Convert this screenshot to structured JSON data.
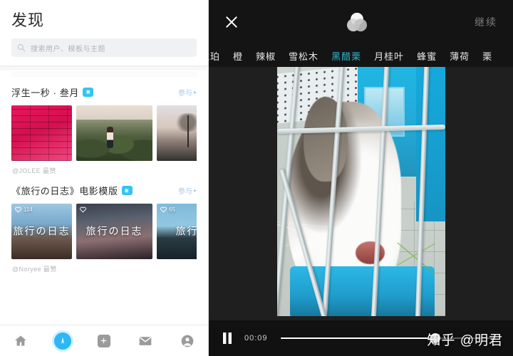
{
  "left_app": {
    "title": "发现",
    "search": {
      "placeholder": "搜索用户、模板与主题",
      "icon": "search-icon"
    },
    "sections": [
      {
        "title": "浮生一秒 · 叁月",
        "badge_text": "新",
        "action_label": "参与",
        "action_chevron": "▸",
        "byline": "@JOLEE 最赞",
        "cards": [
          {
            "art": "brick",
            "caption": "",
            "likes": ""
          },
          {
            "art": "walk",
            "caption": "",
            "likes": ""
          },
          {
            "art": "dusk",
            "caption": "",
            "likes": ""
          }
        ]
      },
      {
        "title": "《旅行の日志》电影模版",
        "badge_text": "新",
        "action_label": "参与",
        "action_chevron": "▸",
        "byline": "@Noryee 最赞",
        "cards": [
          {
            "art": "travel-a",
            "caption": "旅行の日志",
            "likes": "114"
          },
          {
            "art": "travel-b",
            "caption": "旅行の日志",
            "likes": ""
          },
          {
            "art": "travel-c",
            "caption": "旅行",
            "likes": "65"
          }
        ]
      }
    ],
    "tabbar": [
      {
        "name": "home",
        "label": "首页",
        "active": false
      },
      {
        "name": "discover",
        "label": "发现",
        "active": true
      },
      {
        "name": "create",
        "label": "创作",
        "active": false
      },
      {
        "name": "messages",
        "label": "消息",
        "active": false
      },
      {
        "name": "profile",
        "label": "我的",
        "active": false
      }
    ],
    "accent_color": "#2db7f5",
    "badge_color": "#35c3f3"
  },
  "right_app": {
    "topbar": {
      "close_icon": "close-icon",
      "filter_icon": "venn-filter-icon",
      "continue_label": "继续"
    },
    "filters": {
      "selected": "黑醋栗",
      "selected_color": "#33b6c9",
      "items": [
        {
          "label": "琥珀",
          "selected": false,
          "clipped": true
        },
        {
          "label": "橙",
          "selected": false,
          "clipped": false
        },
        {
          "label": "辣椒",
          "selected": false,
          "clipped": false
        },
        {
          "label": "雪松木",
          "selected": false,
          "clipped": false
        },
        {
          "label": "黑醋栗",
          "selected": true,
          "clipped": false
        },
        {
          "label": "月桂叶",
          "selected": false,
          "clipped": false
        },
        {
          "label": "蜂蜜",
          "selected": false,
          "clipped": false
        },
        {
          "label": "薄荷",
          "selected": false,
          "clipped": false
        },
        {
          "label": "栗",
          "selected": false,
          "clipped": true
        }
      ]
    },
    "player": {
      "state_icon": "pause-icon",
      "current_time": "00:09",
      "progress_percent": 72
    },
    "watermark": "知乎 @明君"
  }
}
